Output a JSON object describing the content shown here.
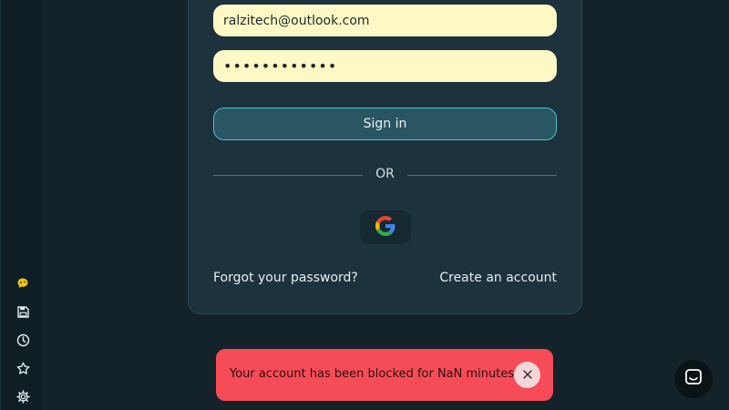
{
  "login": {
    "email_value": "ralzitech@outlook.com",
    "password_value": "••••••••••••",
    "signin_label": "Sign in",
    "divider_label": "OR",
    "forgot_label": "Forgot your password?",
    "create_label": "Create an account"
  },
  "social": {
    "google_icon": "google-g-logo"
  },
  "sidebar": {
    "icons": [
      "chat-bubble-icon",
      "save-icon",
      "clock-icon",
      "star-icon",
      "gear-icon"
    ]
  },
  "toast": {
    "message": "Your account has been blocked for NaN minutes",
    "close_icon": "close-icon",
    "color": "#f64c57"
  },
  "support": {
    "icon": "chat-icon"
  },
  "colors": {
    "background": "#132329",
    "card": "#1c323d",
    "input_fill": "#fdf8c4",
    "button_accent": "#4fc3c9"
  }
}
